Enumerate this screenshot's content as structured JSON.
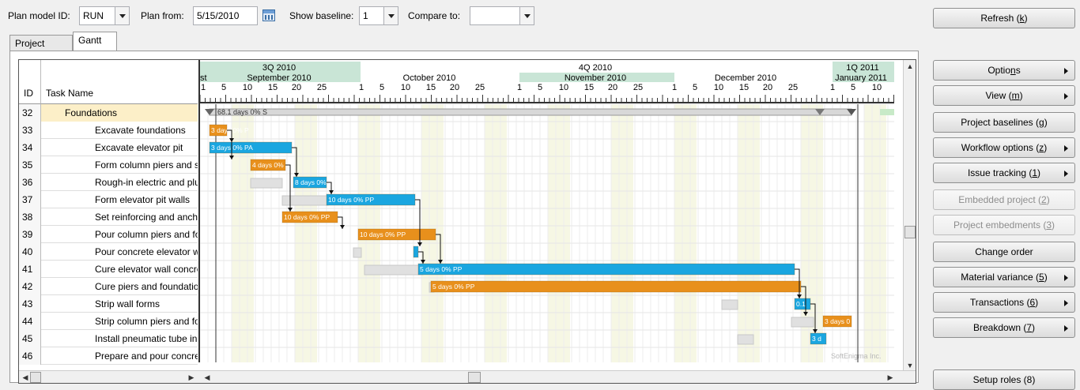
{
  "toolbar": {
    "plan_model_label": "Plan model ID:",
    "plan_model_value": "RUN",
    "plan_from_label": "Plan from:",
    "plan_from_value": "5/15/2010",
    "show_baseline_label": "Show baseline:",
    "show_baseline_value": "1",
    "compare_to_label": "Compare to:",
    "compare_to_value": ""
  },
  "tabs": [
    {
      "label": "Project WBS",
      "active": false
    },
    {
      "label": "Gantt",
      "active": true
    }
  ],
  "table": {
    "col_id": "ID",
    "col_name": "Task Name",
    "rows": [
      {
        "id": "32",
        "name": "Foundations",
        "summary": true
      },
      {
        "id": "33",
        "name": "Excavate foundations"
      },
      {
        "id": "34",
        "name": "Excavate elevator pit"
      },
      {
        "id": "35",
        "name": "Form column piers and sp"
      },
      {
        "id": "36",
        "name": "Rough-in electric and plu"
      },
      {
        "id": "37",
        "name": "Form elevator pit walls"
      },
      {
        "id": "38",
        "name": "Set reinforcing and anchc"
      },
      {
        "id": "39",
        "name": "Pour column piers and fo"
      },
      {
        "id": "40",
        "name": "Pour concrete elevator wa"
      },
      {
        "id": "41",
        "name": "Cure elevator wall concre"
      },
      {
        "id": "42",
        "name": "Cure piers and foundatior"
      },
      {
        "id": "43",
        "name": "Strip wall forms"
      },
      {
        "id": "44",
        "name": "Strip column piers and fo"
      },
      {
        "id": "45",
        "name": "Install pneumatic tube in"
      },
      {
        "id": "46",
        "name": "Prepare and pour concret"
      }
    ]
  },
  "timeline": {
    "quarters": [
      "3Q 2010",
      "4Q 2010",
      "1Q 2011"
    ],
    "months": [
      "st",
      "September 2010",
      "October 2010",
      "November 2010",
      "December 2010",
      "January 2011"
    ],
    "sep_days": [
      "1",
      "5",
      "10",
      "15",
      "20",
      "25"
    ],
    "oct_days": [
      "1",
      "5",
      "10",
      "15",
      "20",
      "25"
    ],
    "nov_days": [
      "1",
      "5",
      "10",
      "15",
      "20",
      "25"
    ],
    "dec_days": [
      "1",
      "5",
      "10",
      "15",
      "20",
      "25"
    ],
    "jan_days": [
      "1",
      "5",
      "10"
    ],
    "summary_label": "68.1 days 0% S",
    "watermark": "SoftEnigma Inc.",
    "bars": [
      {
        "row": 1,
        "color": "#e8901c",
        "label": "3 days 0% P"
      },
      {
        "row": 2,
        "color": "#1aa6e0",
        "label": "3 days 0% PA"
      },
      {
        "row": 3,
        "color": "#e8901c",
        "label": "4 days 0%"
      },
      {
        "row": 4,
        "color": "#1aa6e0",
        "label": "8 days 0%"
      },
      {
        "row": 5,
        "color": "#1aa6e0",
        "label": "10 days 0% PP"
      },
      {
        "row": 6,
        "color": "#e8901c",
        "label": "10 days 0% PP"
      },
      {
        "row": 7,
        "color": "#e8901c",
        "label": "10 days 0% PP"
      },
      {
        "row": 8,
        "color": "#1aa6e0",
        "label": ""
      },
      {
        "row": 9,
        "color": "#1aa6e0",
        "label": "5 days 0% PP"
      },
      {
        "row": 10,
        "color": "#e8901c",
        "label": "5 days 0% PP"
      },
      {
        "row": 11,
        "color": "#1aa6e0",
        "label": "0.1"
      },
      {
        "row": 12,
        "color": "#e8901c",
        "label": "3 days 0"
      },
      {
        "row": 13,
        "color": "#1aa6e0",
        "label": "3 d"
      }
    ]
  },
  "buttons": [
    {
      "label": "Refresh (",
      "key": "k",
      "tail": ")",
      "arrow": false,
      "disabled": false
    },
    {
      "label": "Optio",
      "key": "n",
      "tail": "s",
      "arrow": true,
      "disabled": false
    },
    {
      "label": "View (",
      "key": "m",
      "tail": ")",
      "arrow": true,
      "disabled": false
    },
    {
      "label": "Project baselines (",
      "key": "g",
      "tail": ")",
      "arrow": false,
      "disabled": false
    },
    {
      "label": "Workflow options (",
      "key": "z",
      "tail": ")",
      "arrow": true,
      "disabled": false
    },
    {
      "label": "Issue tracking (",
      "key": "1",
      "tail": ")",
      "arrow": true,
      "disabled": false
    },
    {
      "label": "Embedded project (",
      "key": "2",
      "tail": ")",
      "arrow": false,
      "disabled": true
    },
    {
      "label": "Project embedments (",
      "key": "3",
      "tail": ")",
      "arrow": false,
      "disabled": true
    },
    {
      "label": "Change order",
      "key": "",
      "tail": "",
      "arrow": false,
      "disabled": false
    },
    {
      "label": "Material variance (",
      "key": "5",
      "tail": ")",
      "arrow": true,
      "disabled": false
    },
    {
      "label": "Transactions (",
      "key": "6",
      "tail": ")",
      "arrow": true,
      "disabled": false
    },
    {
      "label": "Breakdown (",
      "key": "7",
      "tail": ")",
      "arrow": true,
      "disabled": false
    },
    {
      "label": "Setup roles (8)",
      "key": "",
      "tail": "",
      "arrow": false,
      "disabled": false
    }
  ]
}
